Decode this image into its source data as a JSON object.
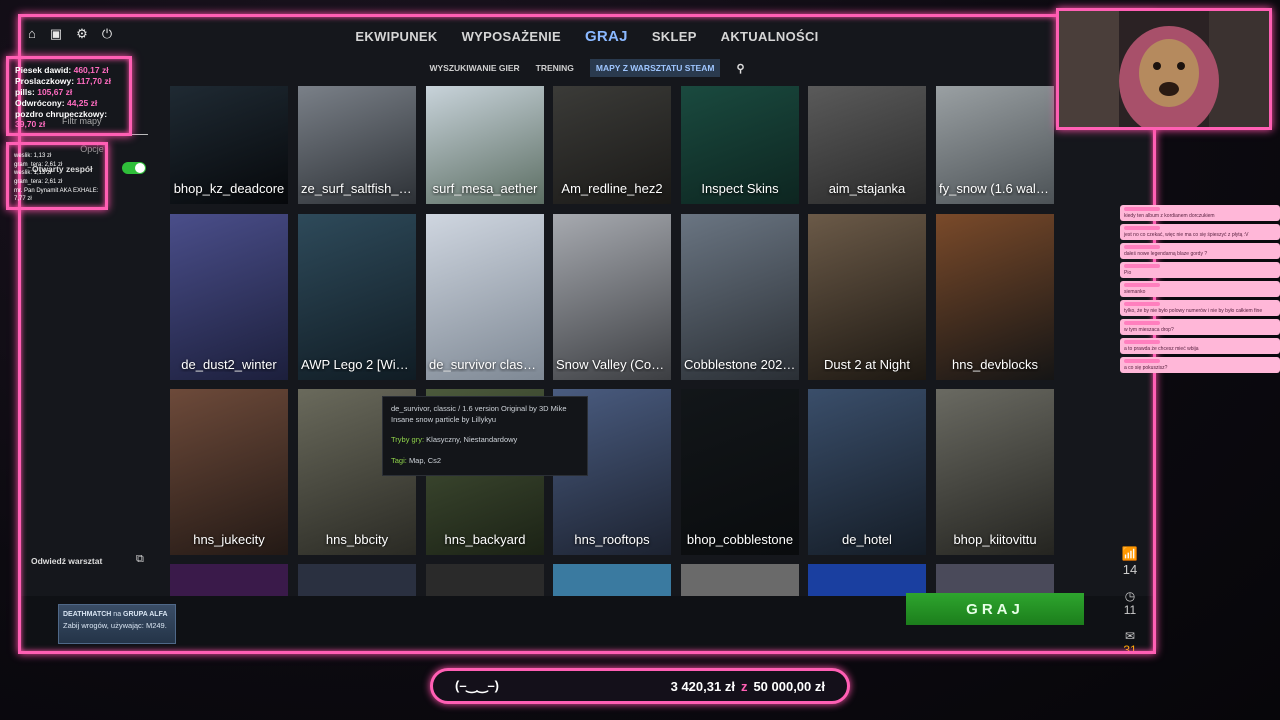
{
  "nav": {
    "tabs": [
      "EKWIPUNEK",
      "WYPOSAŻENIE",
      "GRAJ",
      "SKLEP",
      "AKTUALNOŚCI"
    ],
    "active": "GRAJ",
    "subtabs": [
      "WYSZUKIWANIE GIER",
      "TRENING",
      "MAPY Z WARSZTATU STEAM"
    ],
    "active_subtab": "MAPY Z WARSZTATU STEAM"
  },
  "sidebar": {
    "filter_label": "Filtr mapy",
    "options_label": "Opcje",
    "open_team_label": "Otwarty zespół",
    "visit_workshop": "Odwiedź warsztat"
  },
  "maps": [
    {
      "name": "bhop_kz_deadcore",
      "c1": "#1f2a33",
      "c2": "#06080b"
    },
    {
      "name": "ze_surf_saltfish_cs2",
      "c1": "#7a8088",
      "c2": "#2d3136"
    },
    {
      "name": "surf_mesa_aether",
      "c1": "#c8d3da",
      "c2": "#5c6e63"
    },
    {
      "name": "Am_redline_hez2",
      "c1": "#3b3b38",
      "c2": "#1a1917"
    },
    {
      "name": "Inspect Skins",
      "c1": "#1a4a3f",
      "c2": "#0d2520"
    },
    {
      "name": "aim_stajanka",
      "c1": "#5a5a5a",
      "c2": "#2a2a2a"
    },
    {
      "name": "fy_snow (1.6 wallban...",
      "c1": "#9aa0a3",
      "c2": "#4c5256"
    },
    {
      "name": "de_dust2_winter",
      "c1": "#4a4e8a",
      "c2": "#1c1f3c"
    },
    {
      "name": "AWP Lego 2 [Winter]",
      "c1": "#2e4a5a",
      "c2": "#101c24"
    },
    {
      "name": "de_survivor classic / ...",
      "c1": "#cfd6e0",
      "c2": "#7e8894"
    },
    {
      "name": "Snow Valley (Combat...",
      "c1": "#a7aab0",
      "c2": "#3c3e42"
    },
    {
      "name": "Cobblestone 2023 (C...",
      "c1": "#6a7582",
      "c2": "#2a2f35"
    },
    {
      "name": "Dust 2 at Night",
      "c1": "#6b5a48",
      "c2": "#1d1812"
    },
    {
      "name": "hns_devblocks",
      "c1": "#7a4a2a",
      "c2": "#151515"
    },
    {
      "name": "hns_jukecity",
      "c1": "#6d4a3a",
      "c2": "#231915"
    },
    {
      "name": "hns_bbcity",
      "c1": "#6a6a5c",
      "c2": "#2a2a24"
    },
    {
      "name": "hns_backyard",
      "c1": "#4c5a3c",
      "c2": "#1b2215"
    },
    {
      "name": "hns_rooftops",
      "c1": "#4a5c80",
      "c2": "#1c2230"
    },
    {
      "name": "bhop_cobblestone",
      "c1": "#121619",
      "c2": "#0a0c0e"
    },
    {
      "name": "de_hotel",
      "c1": "#3a4e6a",
      "c2": "#141c26"
    },
    {
      "name": "bhop_kiitovittu",
      "c1": "#6a6a62",
      "c2": "#242420"
    }
  ],
  "tooltip": {
    "desc": "de_survivor, classic / 1.6 version Original by 3D Mike Insane snow particle by Lillykyu",
    "modes_label": "Tryby gry:",
    "modes": "Klasyczny, Niestandardowy",
    "tags_label": "Tagi:",
    "tags": "Map, Cs2"
  },
  "mission": {
    "title": "DEATHMATCH",
    "on": "na",
    "group": "GRUPA ALFA",
    "text": "Zabij wrogów, używając: M249."
  },
  "play_button": "GRAJ",
  "donations": [
    {
      "name": "Piesek dawid:",
      "amount": "460,17 zł"
    },
    {
      "name": "Proslaczkowy:",
      "amount": "117,70 zł"
    },
    {
      "name": "pills:",
      "amount": "105,67 zł"
    },
    {
      "name": "Odwrócony:",
      "amount": "44,25 zł"
    },
    {
      "name": "pozdro chrupeczkowy:",
      "amount": "39,70 zł"
    }
  ],
  "donations_small": [
    "weslik: 1,13 zł",
    "gram_tera: 2,61 zł",
    "weslik: 1,13 zł",
    "gram_tera: 2,61 zł",
    "mr. Pan Dynamit AKA EXHALE: 7,77 zł"
  ],
  "goal": {
    "left": "(–‿‿–)",
    "current": "3 420,31 zł",
    "sep": "z",
    "target": "50 000,00 zł"
  },
  "rightbar": {
    "count_signal": "14",
    "count_clock": "11",
    "count_mail": "31"
  },
  "chat": [
    "kiedy ten album z kordianem dorczukiem",
    "jest no co czekać, więc nie ma co się śpieszyć z płytą :V",
    "dałeś nowe legendarną blaze gordy ?",
    "Pio",
    "siemanko",
    "tylko, że by nie było polowy numerów i nie by było całkiem fine",
    "w tym mieszaca drop?",
    "a to prawda że chcesz mieć wbija",
    "a co się pokuszisz?"
  ],
  "colors": {
    "accent": "#ff5fb4",
    "play": "#2ea52e",
    "tab_active": "#8ab8ff"
  }
}
